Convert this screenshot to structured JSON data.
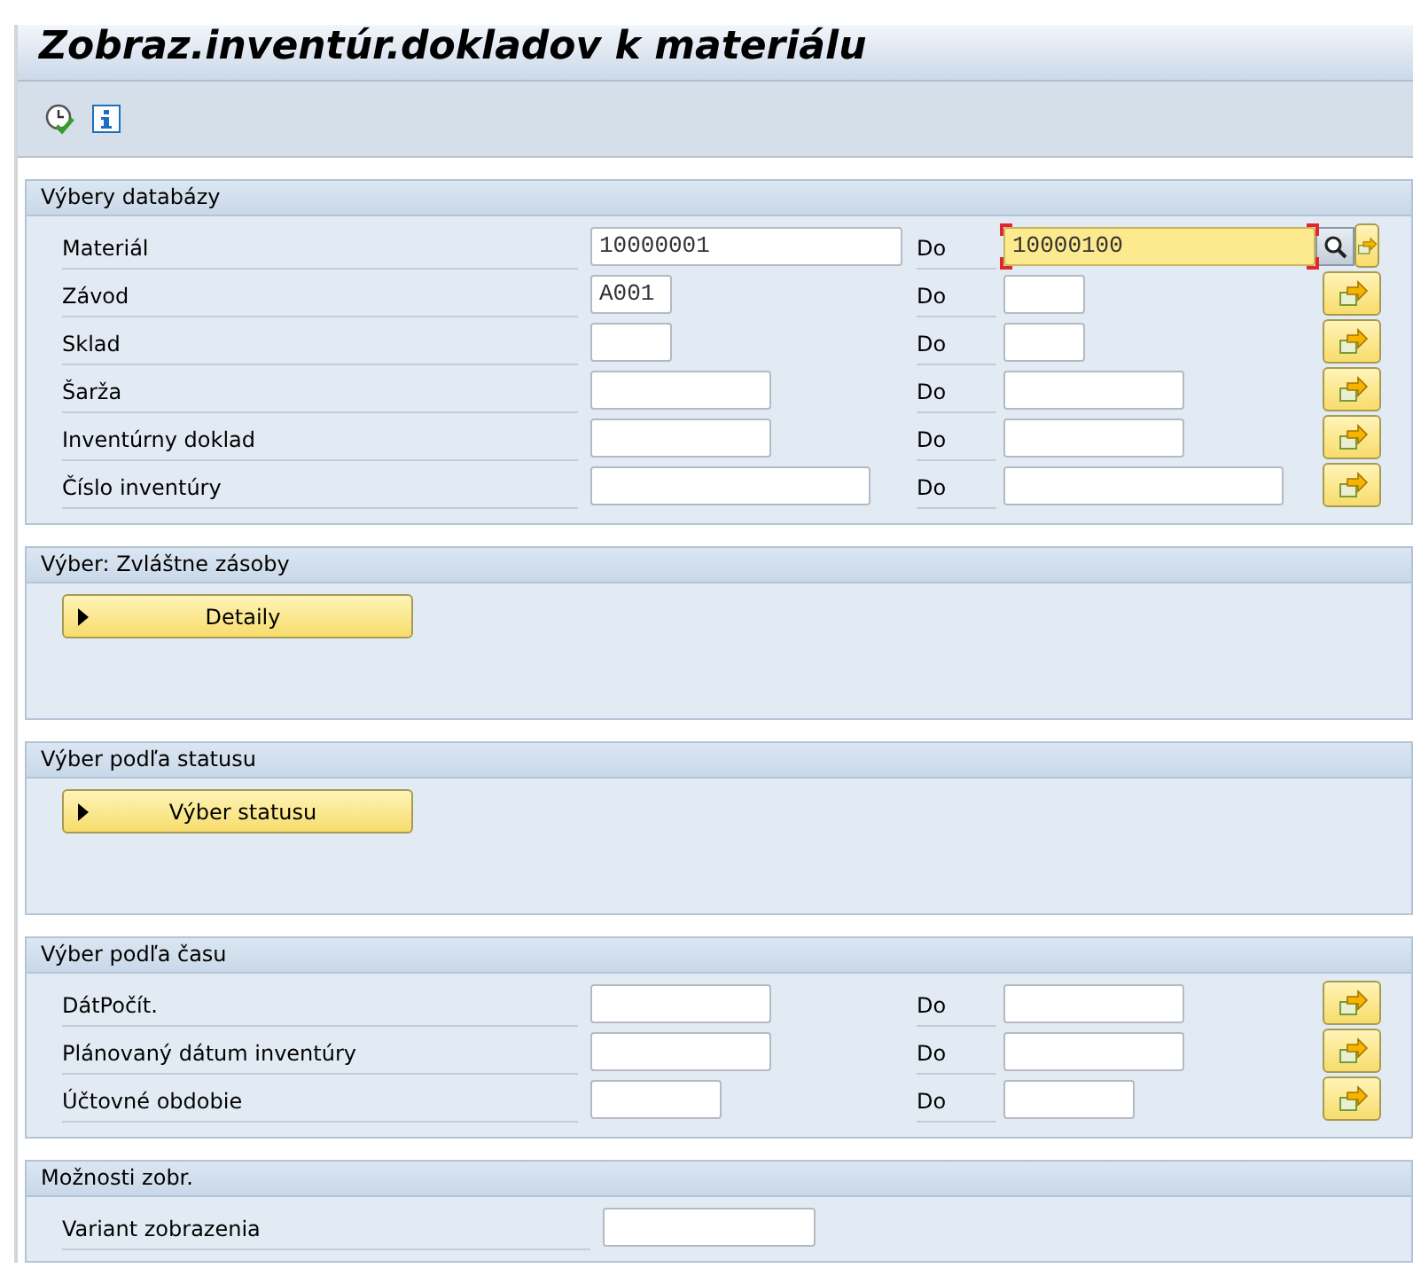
{
  "window": {
    "title": "Zobraz.inventúr.dokladov k materiálu"
  },
  "toolbar": [
    {
      "kind": "execute"
    },
    {
      "kind": "info"
    }
  ],
  "sections": [
    {
      "kind": "ranges",
      "title": "Výbery databázy",
      "rows": [
        {
          "label": "Materiál",
          "from": {
            "value": "10000001"
          },
          "to_label": "Do",
          "to": {
            "value": "10000100",
            "focused": true
          },
          "search_help": true
        },
        {
          "label": "Závod",
          "from": {
            "value": "A001"
          },
          "to_label": "Do",
          "to": {
            "focused": false
          },
          "search_help": false
        },
        {
          "label": "Sklad",
          "from": {},
          "to_label": "Do",
          "to": {
            "focused": false
          },
          "search_help": false
        },
        {
          "label": "Šarža",
          "from": {},
          "to_label": "Do",
          "to": {
            "focused": false
          },
          "search_help": false
        },
        {
          "label": "Inventúrny doklad",
          "from": {},
          "to_label": "Do",
          "to": {
            "focused": false
          },
          "search_help": false
        },
        {
          "label": "Číslo inventúry",
          "from": {},
          "to_label": "Do",
          "to": {
            "focused": false
          },
          "search_help": false
        }
      ]
    },
    {
      "kind": "expander",
      "title": "Výber: Zvláštne zásoby",
      "button": "Detaily"
    },
    {
      "kind": "expander",
      "title": "Výber podľa statusu",
      "button": "Výber statusu"
    },
    {
      "kind": "ranges",
      "title": "Výber podľa času",
      "rows": [
        {
          "label": "DátPočít.",
          "from": {},
          "to_label": "Do",
          "to": {
            "focused": false
          },
          "search_help": false
        },
        {
          "label": "Plánovaný dátum inventúry",
          "from": {},
          "to_label": "Do",
          "to": {
            "focused": false
          },
          "search_help": false
        },
        {
          "label": "Účtovné obdobie",
          "from": {},
          "to_label": "Do",
          "to": {
            "focused": false
          },
          "search_help": false
        }
      ]
    },
    {
      "kind": "params",
      "title": "Možnosti zobr.",
      "rows": [
        {
          "label": "Variant zobrazenia"
        }
      ]
    }
  ]
}
